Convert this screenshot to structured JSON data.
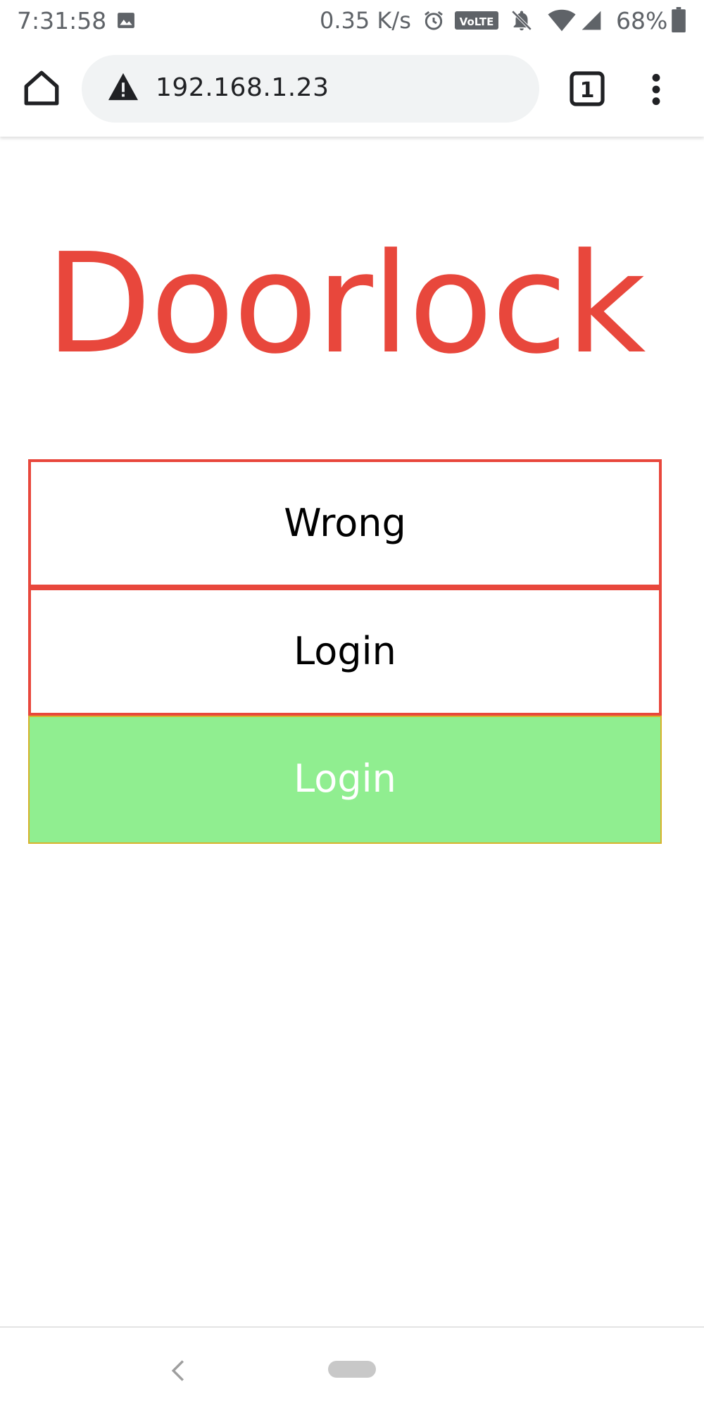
{
  "status_bar": {
    "time": "7:31:58",
    "network_speed": "0.35 K/s",
    "volte_label": "VoLTE",
    "battery_percent": "68%",
    "icons": [
      "image-icon",
      "alarm-icon",
      "volte-icon",
      "notifications-off-icon",
      "wifi-icon",
      "signal-icon",
      "battery-icon"
    ]
  },
  "browser": {
    "url": "192.168.1.23",
    "tab_count": "1",
    "icons": [
      "home-icon",
      "warning-icon",
      "tabs-icon",
      "more-vert-icon"
    ]
  },
  "page": {
    "title": "Doorlock",
    "username_value": "Wrong",
    "password_value": "Login",
    "submit_label": "Login"
  },
  "colors": {
    "title": "#e8473c",
    "field_border": "#e8473c",
    "submit_background": "#90ee90",
    "submit_text": "#ffffff"
  },
  "nav_bar": {
    "icons": [
      "back-icon",
      "home-pill"
    ]
  }
}
